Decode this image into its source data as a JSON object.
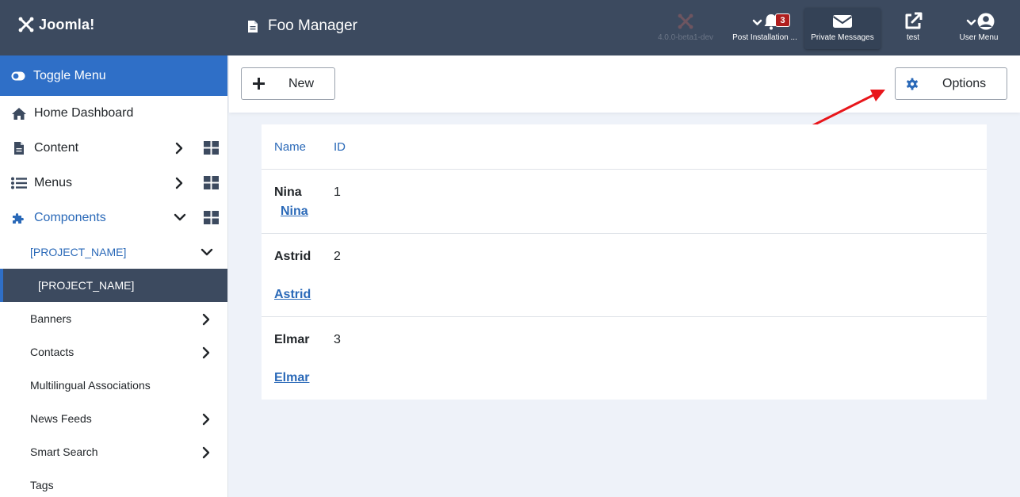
{
  "header": {
    "logo_text": "Joomla!",
    "page_title": "Foo Manager",
    "version_label": "4.0.0-beta1-dev",
    "post_installation_label": "Post Installation ...",
    "post_installation_count": "3",
    "private_messages_label": "Private Messages",
    "site_label": "test",
    "user_menu_label": "User Menu"
  },
  "sidebar": {
    "toggle_label": "Toggle Menu",
    "items": [
      {
        "label": "Home Dashboard",
        "icon": "home-icon"
      },
      {
        "label": "Content",
        "icon": "file-icon"
      },
      {
        "label": "Menus",
        "icon": "list-icon"
      },
      {
        "label": "Components",
        "icon": "puzzle-icon"
      }
    ],
    "sub_items": [
      {
        "label": "[PROJECT_NAME]"
      },
      {
        "label": "[PROJECT_NAME]"
      },
      {
        "label": "Banners"
      },
      {
        "label": "Contacts"
      },
      {
        "label": "Multilingual Associations"
      },
      {
        "label": "News Feeds"
      },
      {
        "label": "Smart Search"
      },
      {
        "label": "Tags"
      }
    ]
  },
  "toolbar": {
    "new_label": "New",
    "options_label": "Options"
  },
  "table": {
    "columns": [
      "Name",
      "ID"
    ],
    "rows": [
      {
        "name": "Nina",
        "id": "1",
        "link": "Nina"
      },
      {
        "name": "Astrid",
        "id": "2",
        "link": "Astrid"
      },
      {
        "name": "Elmar",
        "id": "3",
        "link": "Elmar"
      }
    ]
  },
  "colors": {
    "header_bg": "#3c4a5f",
    "accent": "#2f6fc7",
    "link": "#2a69b8",
    "badge": "#b01e1e",
    "annotation_arrow": "#e8161b"
  }
}
